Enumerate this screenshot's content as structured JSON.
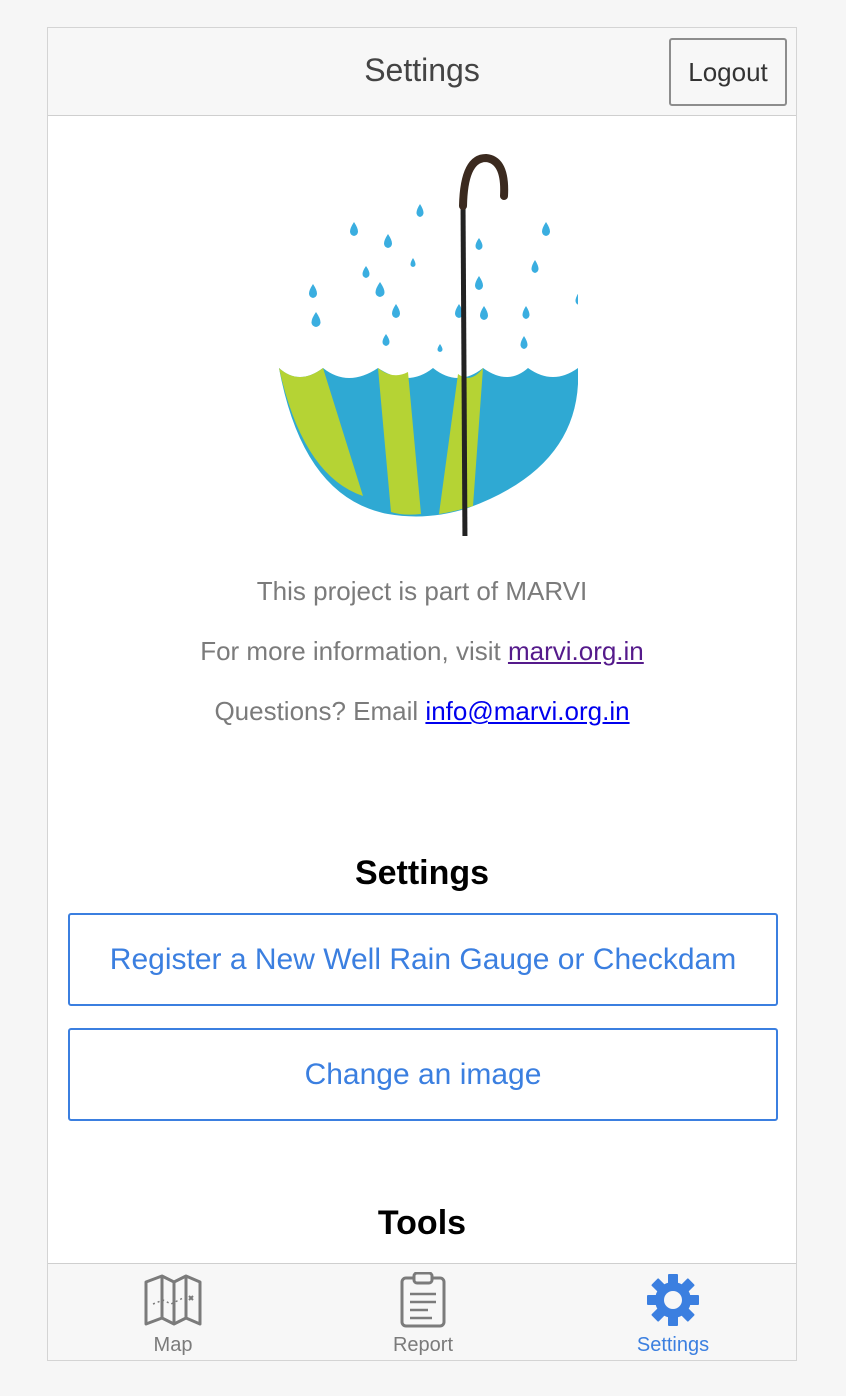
{
  "header": {
    "title": "Settings",
    "logout_label": "Logout"
  },
  "info": {
    "line1": "This project is part of MARVI",
    "line2_prefix": "For more information, visit ",
    "line2_link": "marvi.org.in",
    "line3_prefix": "Questions? Email ",
    "line3_link": "info@marvi.org.in"
  },
  "settings_section": {
    "title": "Settings",
    "buttons": [
      {
        "label": "Register a New Well Rain Gauge or Checkdam"
      },
      {
        "label": "Change an image"
      }
    ]
  },
  "tools_section": {
    "title": "Tools"
  },
  "tabs": [
    {
      "label": "Map",
      "icon": "map-icon",
      "active": false
    },
    {
      "label": "Report",
      "icon": "clipboard-icon",
      "active": false
    },
    {
      "label": "Settings",
      "icon": "gear-icon",
      "active": true
    }
  ],
  "colors": {
    "accent": "#3b7fe0",
    "umbrella_green": "#b5d334",
    "umbrella_blue": "#2fa9d3",
    "drop_blue": "#3aaee0",
    "muted_text": "#7b7b7b"
  }
}
